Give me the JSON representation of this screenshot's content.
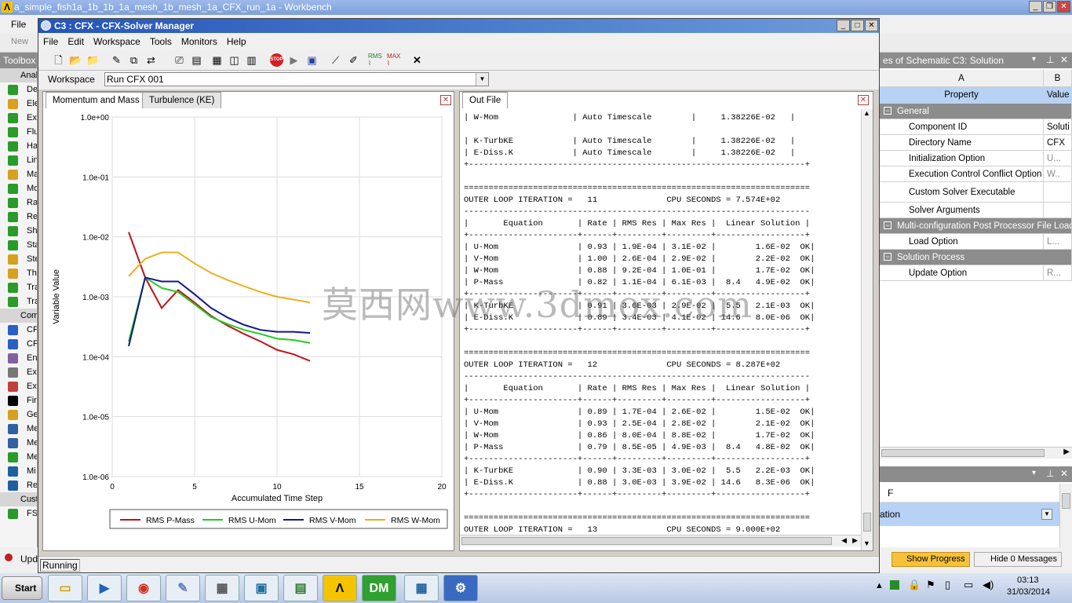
{
  "workbench": {
    "title": "a_simple_fish1a_1b_1b_1a_mesh_1b_mesh_1a_CFX_run_1a - Workbench",
    "menu_file": "File",
    "tool_new": "New",
    "toolbox": "Toolbox",
    "status_text": "Upd",
    "left_items": [
      "Analysis Systems",
      "Design",
      "Ele",
      "Ex",
      "Flu",
      "Ha",
      "Lin",
      "Ma",
      "Mo",
      "Ra",
      "Re",
      "Sh",
      "Sta",
      "Ste",
      "Th",
      "Tra",
      "Tra",
      "Component Systems",
      "CF",
      "CF",
      "En",
      "Ex",
      "Ex",
      "Fir",
      "Ge",
      "Me",
      "Me",
      "Me",
      "Mi",
      "Re",
      "Custom",
      "FS"
    ]
  },
  "props": {
    "title": "es of Schematic C3: Solution",
    "col_a": "A",
    "col_b": "B",
    "hdr_property": "Property",
    "hdr_value": "Value",
    "rows": [
      {
        "type": "group",
        "label": "General"
      },
      {
        "type": "row",
        "label": "Component ID",
        "value": "Soluti"
      },
      {
        "type": "row",
        "label": "Directory Name",
        "value": "CFX"
      },
      {
        "type": "row",
        "label": "Initialization Option",
        "value": "U..."
      },
      {
        "type": "row",
        "label": "Execution Control Conflict Option",
        "value": "W.."
      },
      {
        "type": "row",
        "label": "Custom Solver Executable",
        "value": ""
      },
      {
        "type": "row",
        "label": "Solver Arguments",
        "value": ""
      },
      {
        "type": "group",
        "label": "Multi-configuration Post Processor File Load O"
      },
      {
        "type": "row",
        "label": "Load Option",
        "value": "L..."
      },
      {
        "type": "group",
        "label": "Solution Process"
      },
      {
        "type": "row",
        "label": "Update Option",
        "value": "R..."
      }
    ]
  },
  "msgs": {
    "col_f": "F",
    "row_text": "ation",
    "show_progress": "Show Progress",
    "hide_messages": "Hide 0 Messages"
  },
  "solver": {
    "title": "C3 : CFX - CFX-Solver Manager",
    "menu": [
      "File",
      "Edit",
      "Workspace",
      "Tools",
      "Monitors",
      "Help"
    ],
    "ws_label": "Workspace",
    "ws_value": "Run CFX 001",
    "tab1": "Momentum and Mass",
    "tab2": "Turbulence (KE)",
    "out_tab": "Out File",
    "status": "Running"
  },
  "out_lines": [
    "| W-Mom               | Auto Timescale        |     1.38226E-02   |",
    "",
    "| K-TurbKE            | Auto Timescale        |     1.38226E-02   |",
    "| E-Diss.K            | Auto Timescale        |     1.38226E-02   |",
    "+--------------------------------------------------------------------+",
    "",
    "======================================================================",
    "OUTER LOOP ITERATION =   11              CPU SECONDS = 7.574E+02",
    "----------------------------------------------------------------------",
    "|       Equation       | Rate | RMS Res | Max Res |  Linear Solution |",
    "+----------------------+------+---------+---------+------------------+",
    "| U-Mom                | 0.93 | 1.9E-04 | 3.1E-02 |        1.6E-02  OK|",
    "| V-Mom                | 1.00 | 2.6E-04 | 2.9E-02 |        2.2E-02  OK|",
    "| W-Mom                | 0.88 | 9.2E-04 | 1.0E-01 |        1.7E-02  OK|",
    "| P-Mass               | 0.82 | 1.1E-04 | 6.1E-03 |  8.4   4.9E-02  OK|",
    "+----------------------+------+---------+---------+------------------+",
    "| K-TurbKE             | 0.91 | 3.6E-03 | 2.9E-02 |  5.5   2.1E-03  OK|",
    "| E-Diss.K             | 0.89 | 3.4E-03 | 4.1E-02 | 14.6   8.0E-06  OK|",
    "+----------------------+------+---------+---------+------------------+",
    "",
    "======================================================================",
    "OUTER LOOP ITERATION =   12              CPU SECONDS = 8.287E+02",
    "----------------------------------------------------------------------",
    "|       Equation       | Rate | RMS Res | Max Res |  Linear Solution |",
    "+----------------------+------+---------+---------+------------------+",
    "| U-Mom                | 0.89 | 1.7E-04 | 2.6E-02 |        1.5E-02  OK|",
    "| V-Mom                | 0.93 | 2.5E-04 | 2.8E-02 |        2.1E-02  OK|",
    "| W-Mom                | 0.86 | 8.0E-04 | 8.8E-02 |        1.7E-02  OK|",
    "| P-Mass               | 0.79 | 8.5E-05 | 4.9E-03 |  8.4   4.8E-02  OK|",
    "+----------------------+------+---------+---------+------------------+",
    "| K-TurbKE             | 0.90 | 3.3E-03 | 3.0E-02 |  5.5   2.2E-03  OK|",
    "| E-Diss.K             | 0.88 | 3.0E-03 | 3.9E-02 | 14.6   8.3E-06  OK|",
    "+----------------------+------+---------+---------+------------------+",
    "",
    "======================================================================",
    "OUTER LOOP ITERATION =   13              CPU SECONDS = 9.000E+02"
  ],
  "watermark": "莫西网www.3dmox.com",
  "taskbar": {
    "start": "Start",
    "time": "03:13",
    "date": "31/03/2014"
  },
  "chart_data": {
    "type": "line",
    "xlabel": "Accumulated Time Step",
    "ylabel": "Variable Value",
    "xlim": [
      0,
      20
    ],
    "ylim": [
      1e-06,
      1
    ],
    "yscale": "log",
    "xticks": [
      "0",
      "5",
      "10",
      "15",
      "20"
    ],
    "yticks": [
      "1.0e+00",
      "1.0e-01",
      "1.0e-02",
      "1.0e-03",
      "1.0e-04",
      "1.0e-05",
      "1.0e-06"
    ],
    "series": [
      {
        "name": "RMS P-Mass",
        "color": "#c0141c",
        "x": [
          1,
          2,
          3,
          4,
          5,
          6,
          7,
          8,
          9,
          10,
          11,
          12
        ],
        "values": [
          0.012,
          0.0021,
          0.00065,
          0.0013,
          0.0008,
          0.00048,
          0.00033,
          0.00024,
          0.00018,
          0.00013,
          0.00011,
          8.5e-05
        ]
      },
      {
        "name": "RMS U-Mom",
        "color": "#22cc22",
        "x": [
          1,
          2,
          3,
          4,
          5,
          6,
          7,
          8,
          9,
          10,
          11,
          12
        ],
        "values": [
          0.00018,
          0.0021,
          0.0014,
          0.0012,
          0.00075,
          0.00046,
          0.00035,
          0.00028,
          0.00024,
          0.0002,
          0.00019,
          0.00017
        ]
      },
      {
        "name": "RMS V-Mom",
        "color": "#101890",
        "x": [
          1,
          2,
          3,
          4,
          5,
          6,
          7,
          8,
          9,
          10,
          11,
          12
        ],
        "values": [
          0.00015,
          0.0021,
          0.0018,
          0.0018,
          0.0011,
          0.00065,
          0.00045,
          0.00034,
          0.00028,
          0.00026,
          0.00026,
          0.00025
        ]
      },
      {
        "name": "RMS W-Mom",
        "color": "#e8b020",
        "x": [
          1,
          2,
          3,
          4,
          5,
          6,
          7,
          8,
          9,
          10,
          11,
          12
        ],
        "values": [
          0.0022,
          0.0043,
          0.0055,
          0.0055,
          0.0036,
          0.0025,
          0.0019,
          0.0015,
          0.0012,
          0.001,
          0.0009,
          0.0008
        ]
      }
    ]
  }
}
